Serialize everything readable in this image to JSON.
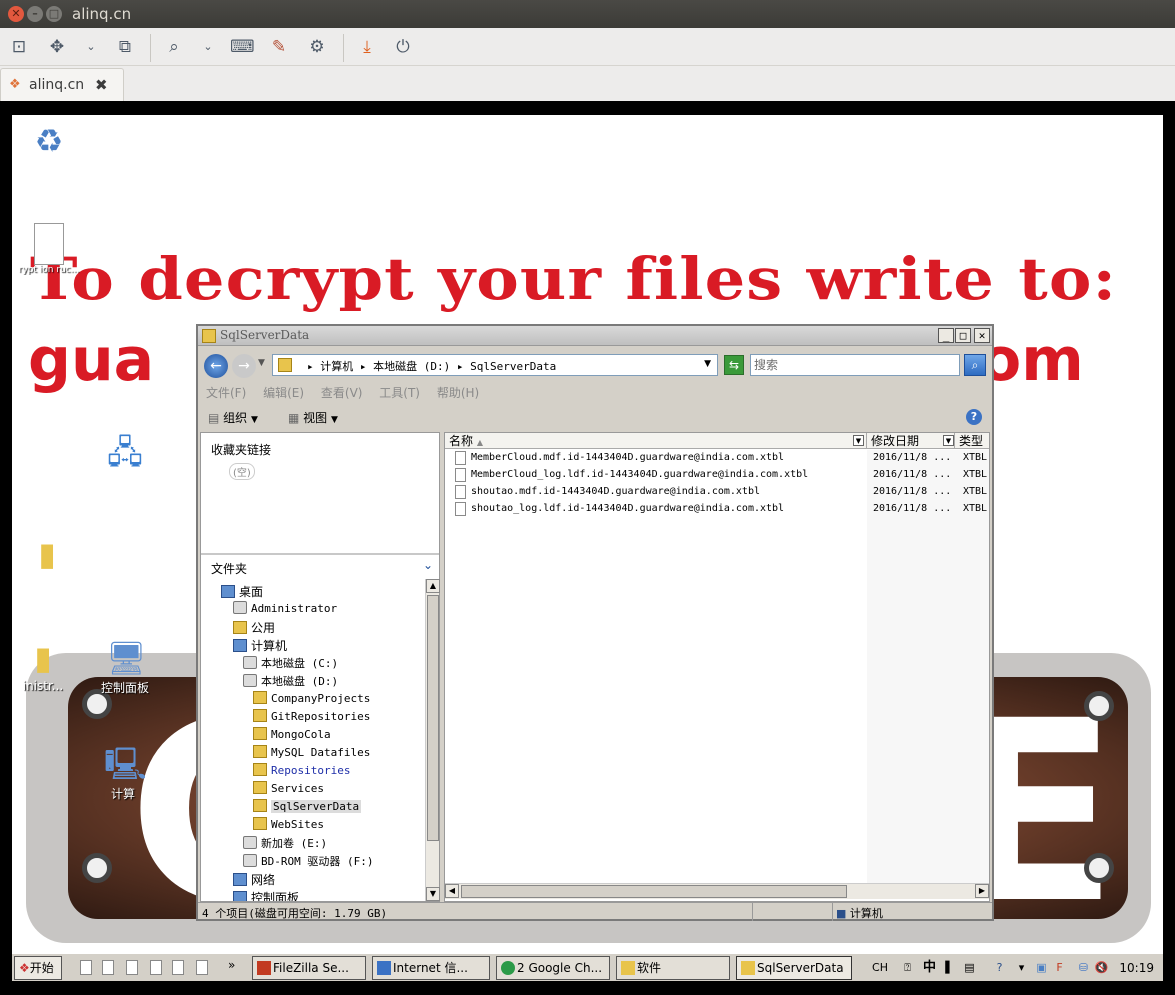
{
  "window": {
    "title": "alinq.cn"
  },
  "tab": {
    "label": "alinq.cn"
  },
  "desktop": {
    "banner_line1": "To decrypt your files write to:",
    "banner_line2_start": "gua",
    "banner_line2_end": "om",
    "icons": [
      {
        "label": ""
      },
      {
        "label": "rypt ion ruc..."
      },
      {
        "label": ""
      },
      {
        "label": ""
      },
      {
        "label": "inistr..."
      },
      {
        "label": "控制面板"
      },
      {
        "label": "计算"
      }
    ],
    "big_letters": [
      "G",
      "E"
    ]
  },
  "explorer": {
    "title": "SqlServerData",
    "address": "▸ 计算机 ▸ 本地磁盘 (D:) ▸ SqlServerData",
    "search_placeholder": "搜索",
    "menu": [
      "文件(F)",
      "编辑(E)",
      "查看(V)",
      "工具(T)",
      "帮助(H)"
    ],
    "cmd_organize": "组织",
    "cmd_views": "视图",
    "favorites_title": "收藏夹链接",
    "favorites_empty": "(空)",
    "folders_title": "文件夹",
    "tree": [
      {
        "label": "桌面",
        "icon": "desktop"
      },
      {
        "label": "Administrator",
        "icon": "user"
      },
      {
        "label": "公用",
        "icon": "folder"
      },
      {
        "label": "计算机",
        "icon": "computer"
      },
      {
        "label": "本地磁盘 (C:)",
        "icon": "drive"
      },
      {
        "label": "本地磁盘 (D:)",
        "icon": "drive"
      },
      {
        "label": "CompanyProjects",
        "icon": "folder"
      },
      {
        "label": "GitRepositories",
        "icon": "folder"
      },
      {
        "label": "MongoCola",
        "icon": "folder"
      },
      {
        "label": "MySQL Datafiles",
        "icon": "folder"
      },
      {
        "label": "Repositories",
        "icon": "folder"
      },
      {
        "label": "Services",
        "icon": "folder"
      },
      {
        "label": "SqlServerData",
        "icon": "folder"
      },
      {
        "label": "WebSites",
        "icon": "folder"
      },
      {
        "label": "新加卷 (E:)",
        "icon": "drive"
      },
      {
        "label": "BD-ROM 驱动器 (F:)",
        "icon": "drive"
      },
      {
        "label": "网络",
        "icon": "network"
      },
      {
        "label": "控制面板",
        "icon": "control-panel"
      }
    ],
    "columns": {
      "name": "名称",
      "date": "修改日期",
      "type": "类型"
    },
    "files": [
      {
        "name": "MemberCloud.mdf.id-1443404D.guardware@india.com.xtbl",
        "date": "2016/11/8 ...",
        "type": "XTBL"
      },
      {
        "name": "MemberCloud_log.ldf.id-1443404D.guardware@india.com.xtbl",
        "date": "2016/11/8 ...",
        "type": "XTBL"
      },
      {
        "name": "shoutao.mdf.id-1443404D.guardware@india.com.xtbl",
        "date": "2016/11/8 ...",
        "type": "XTBL"
      },
      {
        "name": "shoutao_log.ldf.id-1443404D.guardware@india.com.xtbl",
        "date": "2016/11/8 ...",
        "type": "XTBL"
      }
    ],
    "status_text": "4 个项目(磁盘可用空间: 1.79 GB)",
    "status_computer": "计算机"
  },
  "taskbar": {
    "start": "开始",
    "more": "»",
    "tasks": [
      {
        "label": "FileZilla Se..."
      },
      {
        "label": "Internet 信..."
      },
      {
        "label": "2 Google Ch..."
      },
      {
        "label": "软件"
      },
      {
        "label": "SqlServerData"
      }
    ],
    "lang": "CH",
    "ime": "中",
    "clock": "10:19"
  },
  "colors": {
    "banner_red": "#d91b25",
    "title_bar": "#3c3b37",
    "close_button": "#e2583e"
  }
}
